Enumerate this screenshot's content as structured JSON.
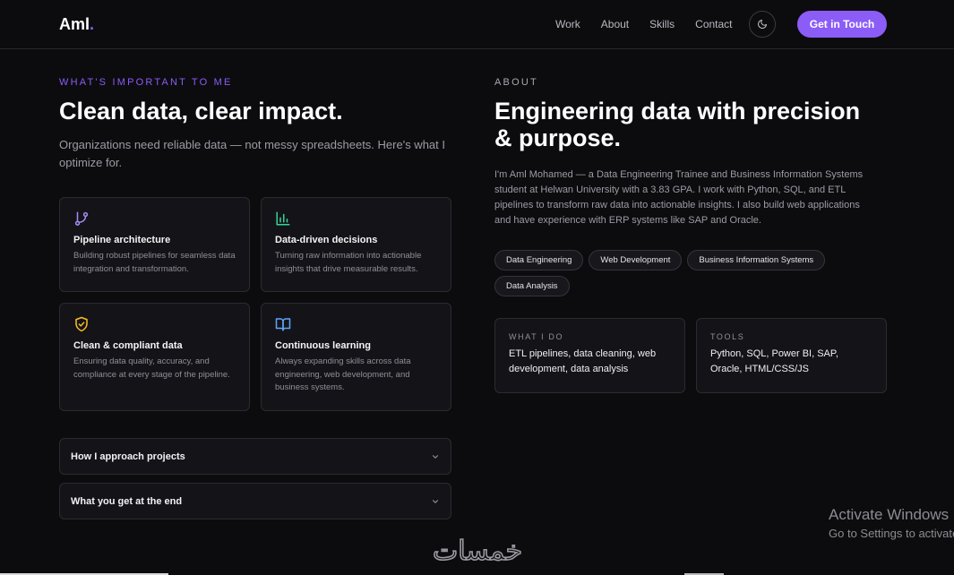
{
  "nav": {
    "logo_text": "Aml",
    "logo_dot": ".",
    "links": [
      "Work",
      "About",
      "Skills",
      "Contact"
    ],
    "theme_icon": "moon-icon",
    "cta_label": "Get in Touch"
  },
  "values": {
    "eyebrow": "WHAT'S IMPORTANT TO ME",
    "title": "Clean data, clear impact.",
    "lead": "Organizations need reliable data — not messy spreadsheets. Here's what I optimize for.",
    "cards": [
      {
        "icon": "git-branch-icon",
        "title": "Pipeline architecture",
        "desc": "Building robust pipelines for seamless data integration and transformation.",
        "color": "#a78bfa"
      },
      {
        "icon": "bar-chart-icon",
        "title": "Data-driven decisions",
        "desc": "Turning raw information into actionable insights that drive measurable results.",
        "color": "#34d399"
      },
      {
        "icon": "shield-check-icon",
        "title": "Clean & compliant data",
        "desc": "Ensuring data quality, accuracy, and compliance at every stage of the pipeline.",
        "color": "#fbbf24"
      },
      {
        "icon": "book-open-icon",
        "title": "Continuous learning",
        "desc": "Always expanding skills across data engineering, web development, and business systems.",
        "color": "#60a5fa"
      }
    ],
    "accordions": [
      "How I approach projects",
      "What you get at the end"
    ]
  },
  "about": {
    "eyebrow": "ABOUT",
    "title": "Engineering data with precision & purpose.",
    "text": "I'm Aml Mohamed — a Data Engineering Trainee and Business Information Systems student at Helwan University with a 3.83 GPA. I work with Python, SQL, and ETL pipelines to transform raw data into actionable insights. I also build web applications and have experience with ERP systems like SAP and Oracle.",
    "tags": [
      "Data Engineering",
      "Web Development",
      "Business Information Systems",
      "Data Analysis"
    ],
    "what_i_do": {
      "label": "WHAT I DO",
      "value": "ETL pipelines, data cleaning, web development, data analysis"
    },
    "tools": {
      "label": "TOOLS",
      "value": "Python, SQL, Power BI, SAP, Oracle, HTML/CSS/JS"
    }
  },
  "overlay": {
    "activate_title": "Activate Windows",
    "activate_sub": "Go to Settings to activate Windows.",
    "site_logo_text": "خمسات"
  },
  "colors": {
    "accent": "#8b5cf6",
    "background": "#0c0c0f"
  }
}
